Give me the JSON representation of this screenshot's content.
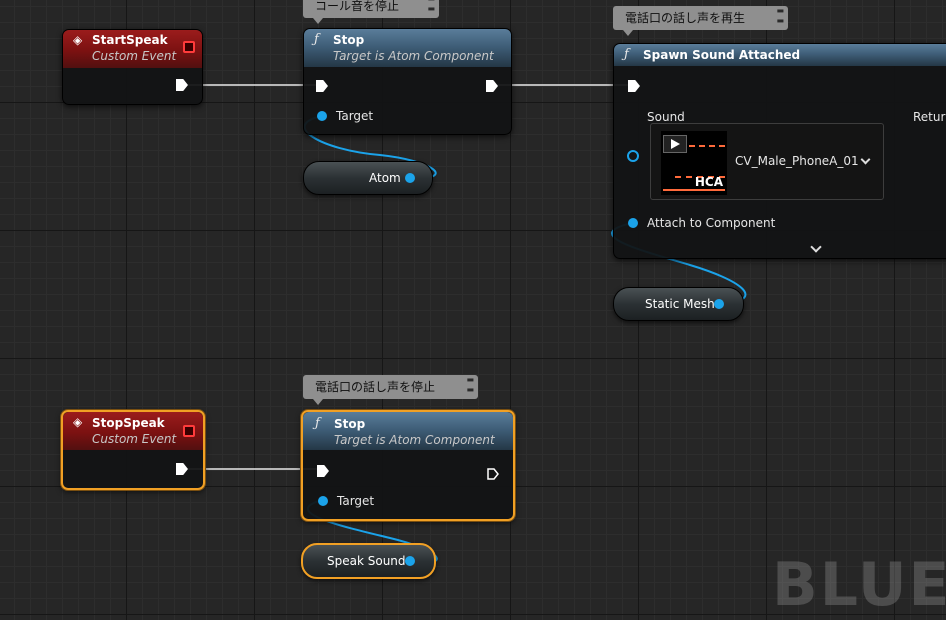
{
  "comments": {
    "stop_call": "コール音を停止",
    "play_voice": "電話口の話し声を再生",
    "stop_voice": "電話口の話し声を停止"
  },
  "start_event": {
    "title": "StartSpeak",
    "subtitle": "Custom Event"
  },
  "stop_event": {
    "title": "StopSpeak",
    "subtitle": "Custom Event"
  },
  "stop_node_1": {
    "icon": "ƒ",
    "title": "Stop",
    "subtitle": "Target is Atom Component",
    "target_label": "Target"
  },
  "stop_node_2": {
    "icon": "ƒ",
    "title": "Stop",
    "subtitle": "Target is Atom Component",
    "target_label": "Target"
  },
  "spawn_node": {
    "icon": "ƒ",
    "title": "Spawn Sound Attached",
    "sound_label": "Sound",
    "return_label": "Return",
    "asset_name": "CV_Male_PhoneA_01",
    "asset_format": "HCA",
    "attach_label": "Attach to Component"
  },
  "variables": {
    "atom": "Atom",
    "static_mesh": "Static Mesh",
    "speak_sound": "Speak Sound"
  },
  "watermark": "BLUEPRINT",
  "colors": {
    "event_header": "#7b1111",
    "function_header": "#3f5e78",
    "object_pin": "#1ba3ea",
    "selection": "#f1a024",
    "exec_wire": "#ffffff"
  }
}
